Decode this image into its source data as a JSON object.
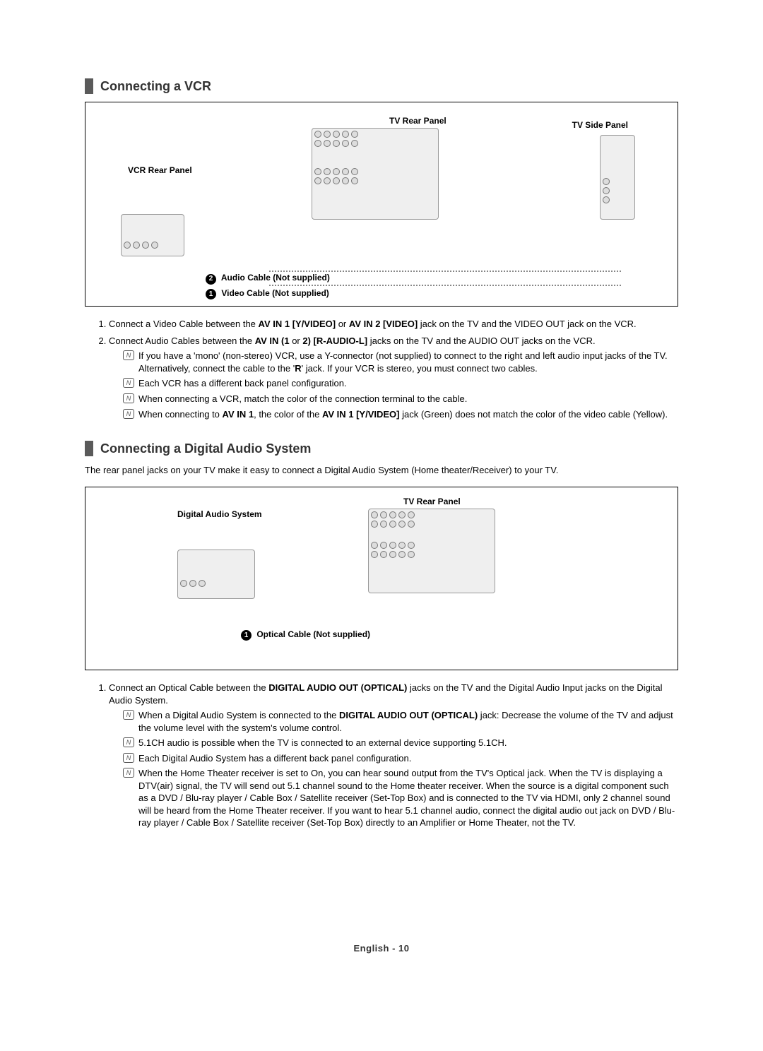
{
  "sections": [
    {
      "title": "Connecting a VCR",
      "diagram": {
        "labels": {
          "vcr_rear": "VCR Rear Panel",
          "tv_rear": "TV Rear Panel",
          "tv_side": "TV Side Panel"
        },
        "cables": [
          {
            "num": "2",
            "text": "Audio Cable (Not supplied)"
          },
          {
            "num": "1",
            "text": "Video Cable (Not supplied)"
          }
        ]
      },
      "steps": [
        {
          "num": "1.",
          "text_parts": [
            {
              "t": "Connect a Video Cable between the ",
              "b": false
            },
            {
              "t": "AV IN 1 [Y/VIDEO]",
              "b": true
            },
            {
              "t": " or ",
              "b": false
            },
            {
              "t": "AV IN 2 [VIDEO]",
              "b": true
            },
            {
              "t": " jack on the TV and the VIDEO OUT jack on the VCR.",
              "b": false
            }
          ],
          "notes": []
        },
        {
          "num": "2.",
          "text_parts": [
            {
              "t": "Connect Audio Cables between the ",
              "b": false
            },
            {
              "t": "AV IN (1",
              "b": true
            },
            {
              "t": " or ",
              "b": false
            },
            {
              "t": "2) [R-AUDIO-L]",
              "b": true
            },
            {
              "t": " jacks on the TV and the AUDIO OUT jacks on the VCR.",
              "b": false
            }
          ],
          "notes": [
            {
              "parts": [
                {
                  "t": "If you have a 'mono' (non-stereo) VCR, use a Y-connector (not supplied) to connect to the right and left audio input jacks of the TV. Alternatively, connect the cable to the '",
                  "b": false
                },
                {
                  "t": "R",
                  "b": true
                },
                {
                  "t": "' jack. If your VCR is stereo, you must connect two cables.",
                  "b": false
                }
              ]
            },
            {
              "parts": [
                {
                  "t": "Each VCR has a different back panel configuration.",
                  "b": false
                }
              ]
            },
            {
              "parts": [
                {
                  "t": "When connecting a VCR, match the color of the connection terminal to the cable.",
                  "b": false
                }
              ]
            },
            {
              "parts": [
                {
                  "t": "When connecting to ",
                  "b": false
                },
                {
                  "t": "AV IN 1",
                  "b": true
                },
                {
                  "t": ", the color of the ",
                  "b": false
                },
                {
                  "t": "AV IN 1 [Y/VIDEO]",
                  "b": true
                },
                {
                  "t": " jack (Green) does not match the color of the video cable (Yellow).",
                  "b": false
                }
              ]
            }
          ]
        }
      ]
    },
    {
      "title": "Connecting a Digital Audio System",
      "intro": "The rear panel jacks on your TV make it easy to connect a Digital Audio System (Home theater/Receiver) to your TV.",
      "diagram": {
        "labels": {
          "das": "Digital Audio System",
          "tv_rear": "TV Rear Panel"
        },
        "cables": [
          {
            "num": "1",
            "text": "Optical Cable (Not supplied)"
          }
        ]
      },
      "steps": [
        {
          "num": "1.",
          "text_parts": [
            {
              "t": "Connect an Optical Cable between the ",
              "b": false
            },
            {
              "t": "DIGITAL AUDIO OUT (OPTICAL)",
              "b": true
            },
            {
              "t": " jacks on the TV and the Digital Audio Input jacks on the Digital Audio System.",
              "b": false
            }
          ],
          "notes": [
            {
              "parts": [
                {
                  "t": "When a Digital Audio System is connected to the ",
                  "b": false
                },
                {
                  "t": "DIGITAL AUDIO OUT (OPTICAL)",
                  "b": true
                },
                {
                  "t": " jack: Decrease the volume of the TV and adjust the volume level with the system's volume control.",
                  "b": false
                }
              ]
            },
            {
              "parts": [
                {
                  "t": "5.1CH audio is possible when the TV is connected to an external device supporting 5.1CH.",
                  "b": false
                }
              ]
            },
            {
              "parts": [
                {
                  "t": "Each Digital Audio System has a different back panel configuration.",
                  "b": false
                }
              ]
            },
            {
              "parts": [
                {
                  "t": "When the Home Theater receiver is set to On, you can hear sound output from the TV's Optical jack. When the TV is displaying a DTV(air) signal, the TV will send out 5.1 channel sound to the Home theater receiver. When the source is a digital component such as a DVD / Blu-ray player / Cable Box / Satellite receiver (Set-Top Box) and is connected to the TV via HDMI, only 2 channel sound will be heard from the Home Theater receiver. If you want to hear 5.1 channel audio, connect the digital audio out jack on DVD / Blu-ray player / Cable Box / Satellite receiver (Set-Top Box) directly to an Amplifier or Home Theater, not the TV.",
                  "b": false
                }
              ]
            }
          ]
        }
      ]
    }
  ],
  "footer": "English - 10",
  "note_glyph": "N"
}
